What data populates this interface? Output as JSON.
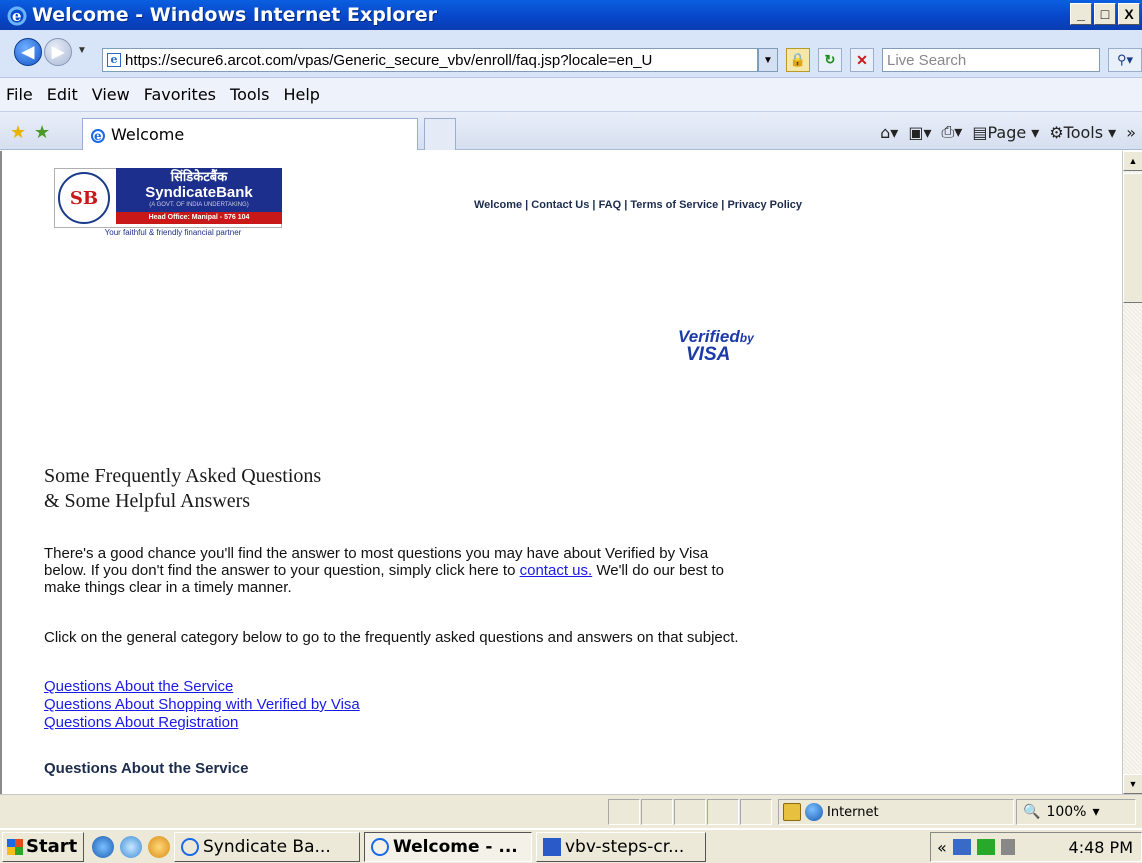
{
  "window": {
    "title": "Welcome - Windows Internet Explorer",
    "minimize": "_",
    "maximize": "□",
    "close": "X"
  },
  "address": {
    "url": "https://secure6.arcot.com/vpas/Generic_secure_vbv/enroll/faq.jsp?locale=en_U",
    "search_placeholder": "Live Search"
  },
  "menu": [
    "File",
    "Edit",
    "View",
    "Favorites",
    "Tools",
    "Help"
  ],
  "tab": {
    "label": "Welcome"
  },
  "command_bar": {
    "page_label": "Page",
    "tools_label": "Tools",
    "chevron": "»"
  },
  "page": {
    "bank_hindi": "सिंडिकेटबैंक",
    "bank_name": "SyndicateBank",
    "bank_govt": "(A GOVT. OF INDIA UNDERTAKING)",
    "bank_head_office": "Head Office: Manipal - 576 104",
    "bank_tagline": "Your faithful & friendly financial partner",
    "nav": [
      "Welcome",
      "Contact Us",
      "FAQ",
      "Terms of Service",
      "Privacy Policy"
    ],
    "vbv_verified": "Verified",
    "vbv_by": "by",
    "vbv_visa": "VISA",
    "heading_line1": "Some Frequently Asked Questions",
    "heading_line2": "& Some Helpful Answers",
    "para1_before": "There's a good chance you'll find the answer to most questions you may have about Verified by Visa below. If you don't find the answer to your question, simply click here to ",
    "para1_link": "contact us.",
    "para1_after": " We'll do our best to make things clear in a timely manner.",
    "para2": "Click on the general category below to go to the frequently asked questions and answers on that subject.",
    "links": [
      "Questions About the Service",
      "Questions About Shopping with Verified by Visa",
      "Questions About Registration"
    ],
    "section_heading": "Questions About the Service"
  },
  "status": {
    "zone": "Internet",
    "zoom": "100%"
  },
  "taskbar": {
    "start": "Start",
    "tasks": [
      "Syndicate Ba...",
      "Welcome - ...",
      "vbv-steps-cr..."
    ],
    "tray_chevron": "«",
    "clock": "4:48 PM"
  }
}
